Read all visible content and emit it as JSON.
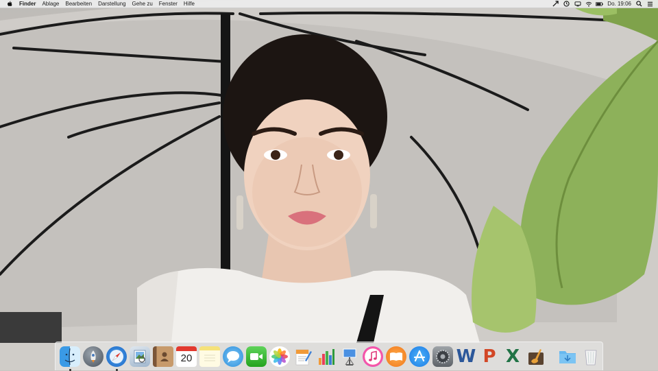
{
  "menubar": {
    "apple_icon": "apple-logo-icon",
    "app_name": "Finder",
    "menus": [
      "Ablage",
      "Bearbeiten",
      "Darstellung",
      "Gehe zu",
      "Fenster",
      "Hilfe"
    ],
    "status_icons": [
      "scroll-arrow-icon",
      "time-machine-icon",
      "display-icon",
      "wifi-icon",
      "battery-icon"
    ],
    "clock": "Do. 19:06",
    "status_icons_trailing": [
      "search-icon",
      "list-icon"
    ]
  },
  "dock": {
    "apps": [
      {
        "name": "Finder",
        "icon": "finder-icon",
        "running": true
      },
      {
        "name": "Launchpad",
        "icon": "launchpad-icon"
      },
      {
        "name": "Safari",
        "icon": "safari-icon",
        "running": true
      },
      {
        "name": "Preview",
        "icon": "preview-icon"
      },
      {
        "name": "Contacts",
        "icon": "contacts-icon"
      },
      {
        "name": "Calendar",
        "icon": "calendar-icon",
        "date": "20"
      },
      {
        "name": "Notes",
        "icon": "notes-icon"
      },
      {
        "name": "Messages",
        "icon": "messages-icon"
      },
      {
        "name": "FaceTime",
        "icon": "facetime-icon"
      },
      {
        "name": "Photos",
        "icon": "photos-icon"
      },
      {
        "name": "Pages",
        "icon": "pages-icon"
      },
      {
        "name": "Numbers",
        "icon": "numbers-icon"
      },
      {
        "name": "Keynote",
        "icon": "keynote-icon"
      },
      {
        "name": "iTunes",
        "icon": "itunes-icon"
      },
      {
        "name": "iBooks",
        "icon": "ibooks-icon"
      },
      {
        "name": "App Store",
        "icon": "app-store-icon"
      },
      {
        "name": "System Preferences",
        "icon": "system-preferences-icon"
      },
      {
        "name": "Word",
        "icon": "word-icon",
        "letter": "W"
      },
      {
        "name": "PowerPoint",
        "icon": "powerpoint-icon",
        "letter": "P"
      },
      {
        "name": "Excel",
        "icon": "excel-icon",
        "letter": "X"
      },
      {
        "name": "GarageBand",
        "icon": "garageband-icon"
      }
    ],
    "stacks": [
      {
        "name": "Downloads",
        "icon": "downloads-folder-icon"
      },
      {
        "name": "Trash",
        "icon": "trash-icon"
      }
    ]
  },
  "colors": {
    "menubar_bg": "#ececec",
    "dock_bg": "#e6e6e6",
    "word_blue": "#2b579a",
    "powerpoint_red": "#d24726",
    "excel_green": "#217346"
  }
}
